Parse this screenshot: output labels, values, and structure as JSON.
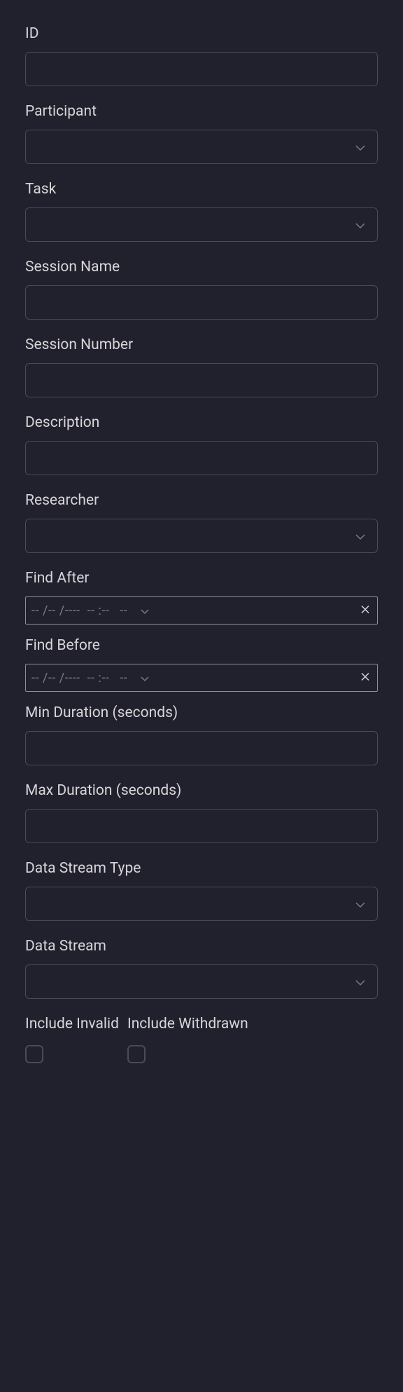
{
  "labels": {
    "id": "ID",
    "participant": "Participant",
    "task": "Task",
    "session_name": "Session Name",
    "session_number": "Session Number",
    "description": "Description",
    "researcher": "Researcher",
    "find_after": "Find After",
    "find_before": "Find Before",
    "min_duration": "Min Duration (seconds)",
    "max_duration": "Max Duration (seconds)",
    "data_stream_type": "Data Stream Type",
    "data_stream": "Data Stream",
    "include_invalid": "Include Invalid",
    "include_withdrawn": "Include Withdrawn"
  },
  "values": {
    "id": "",
    "participant": "",
    "task": "",
    "session_name": "",
    "session_number": "",
    "description": "",
    "researcher": "",
    "find_after": "",
    "find_before": "",
    "min_duration": "",
    "max_duration": "",
    "data_stream_type": "",
    "data_stream": "",
    "include_invalid": false,
    "include_withdrawn": false
  },
  "datetime_placeholder": {
    "dd": "--",
    "mm": "--",
    "yyyy": "----",
    "hh": "--",
    "min": "--",
    "ampm": "--"
  }
}
